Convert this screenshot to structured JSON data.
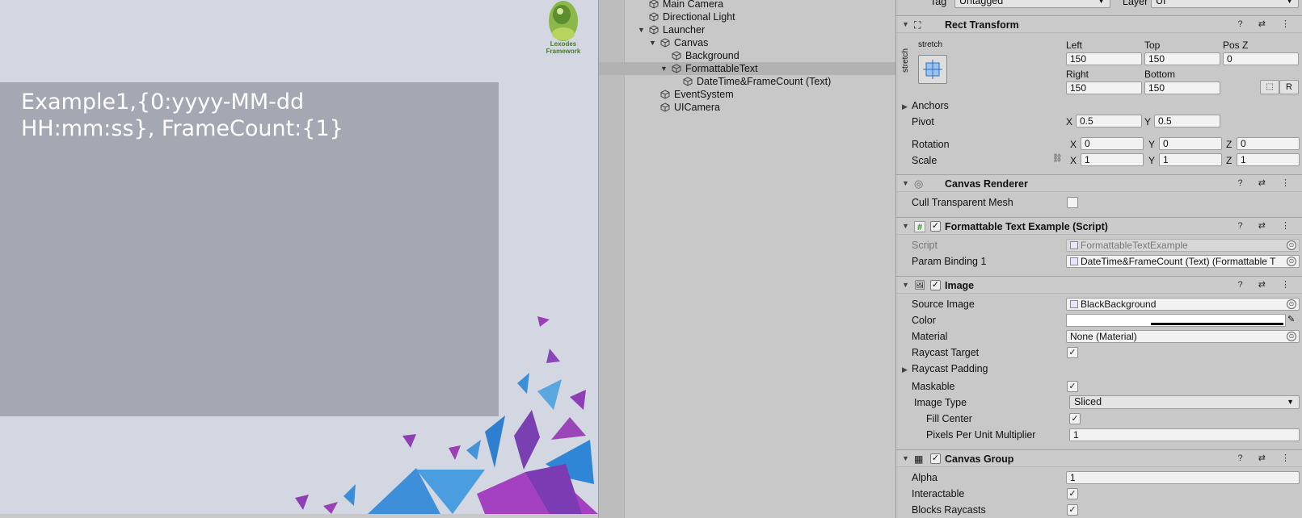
{
  "game": {
    "text": "Example1,{0:yyyy-MM-dd HH:mm:ss}, FrameCount:{1}",
    "logo_text": "Lexodes Framework"
  },
  "hierarchy": {
    "items": [
      {
        "label": "Main Camera"
      },
      {
        "label": "Directional Light"
      },
      {
        "label": "Launcher"
      },
      {
        "label": "Canvas"
      },
      {
        "label": "Background"
      },
      {
        "label": "FormattableText"
      },
      {
        "label": "DateTime&FrameCount (Text)"
      },
      {
        "label": "EventSystem"
      },
      {
        "label": "UICamera"
      }
    ]
  },
  "inspector": {
    "tag_label": "Tag",
    "tag_value": "Untagged",
    "layer_label": "Layer",
    "layer_value": "UI",
    "rect_transform": {
      "title": "Rect Transform",
      "stretch_top": "stretch",
      "stretch_side": "stretch",
      "left_label": "Left",
      "left": "150",
      "top_label": "Top",
      "top": "150",
      "posz_label": "Pos Z",
      "posz": "0",
      "right_label": "Right",
      "right": "150",
      "bottom_label": "Bottom",
      "bottom": "150",
      "r_button": "R",
      "anchors_label": "Anchors",
      "pivot_label": "Pivot",
      "pivot_x": "0.5",
      "pivot_y": "0.5",
      "rotation_label": "Rotation",
      "rot_x": "0",
      "rot_y": "0",
      "rot_z": "0",
      "scale_label": "Scale",
      "scale_x": "1",
      "scale_y": "1",
      "scale_z": "1",
      "x": "X",
      "y": "Y",
      "z": "Z"
    },
    "canvas_renderer": {
      "title": "Canvas Renderer",
      "cull_label": "Cull Transparent Mesh"
    },
    "script_comp": {
      "title": "Formattable Text Example (Script)",
      "script_label": "Script",
      "script_value": "FormattableTextExample",
      "param_label": "Param Binding 1",
      "param_value": "DateTime&FrameCount (Text) (Formattable T"
    },
    "image": {
      "title": "Image",
      "source_label": "Source Image",
      "source_value": "BlackBackground",
      "color_label": "Color",
      "material_label": "Material",
      "material_value": "None (Material)",
      "raycast_target_label": "Raycast Target",
      "raycast_padding_label": "Raycast Padding",
      "maskable_label": "Maskable",
      "image_type_label": "Image Type",
      "image_type_value": "Sliced",
      "fill_center_label": "Fill Center",
      "ppu_label": "Pixels Per Unit Multiplier",
      "ppu_value": "1"
    },
    "canvas_group": {
      "title": "Canvas Group",
      "alpha_label": "Alpha",
      "alpha_value": "1",
      "interactable_label": "Interactable",
      "blocks_label": "Blocks Raycasts"
    },
    "checkmark": "✓",
    "header_icons": "? ⇄ ⋮"
  }
}
